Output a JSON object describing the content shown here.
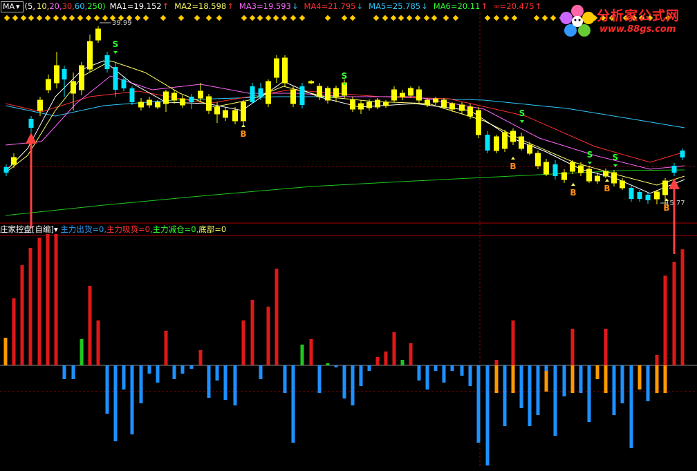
{
  "header": {
    "menu_label": "MA",
    "params_prefix": "(5,",
    "params": [
      {
        "text": "10,",
        "color": "#ffff66"
      },
      {
        "text": "20,",
        "color": "#ff66ff"
      },
      {
        "text": "30,",
        "color": "#ff3030"
      },
      {
        "text": "60,",
        "color": "#30c8ff"
      },
      {
        "text": "250)",
        "color": "#30ff30"
      }
    ],
    "ma_values": [
      {
        "text": "MA1=19.152",
        "arrow": "↑",
        "color": "#ffffff",
        "arrow_color": "#ff3030"
      },
      {
        "text": "MA2=18.598",
        "arrow": "↑",
        "color": "#ffff66",
        "arrow_color": "#ff3030"
      },
      {
        "text": "MA3=19.593",
        "arrow": "↓",
        "color": "#ff66ff",
        "arrow_color": "#30c8ff"
      },
      {
        "text": "MA4=21.795",
        "arrow": "↓",
        "color": "#ff3030",
        "arrow_color": "#30c8ff"
      },
      {
        "text": "MA5=25.785",
        "arrow": "↓",
        "color": "#30c8ff",
        "arrow_color": "#30c8ff"
      },
      {
        "text": "MA6=20.11",
        "arrow": "↑",
        "color": "#30ff30",
        "arrow_color": "#ff3030"
      },
      {
        "text": "∞=20.475",
        "arrow": "↑",
        "color": "#ff3030",
        "arrow_color": "#ff3030"
      }
    ]
  },
  "indicator": {
    "name": "庄家控盘[自编]",
    "items": [
      {
        "text": "主力出货=0,",
        "color": "#30a0ff"
      },
      {
        "text": "主力吸货=0",
        "color": "#ff3030"
      },
      {
        "text": ",主力减仓=0,",
        "color": "#30ff30"
      },
      {
        "text": "底部=0",
        "color": "#ffff66"
      }
    ]
  },
  "price_labels": {
    "high": "39.99",
    "low": "15.77"
  },
  "signal_labels": {
    "sell": "S",
    "buy": "B"
  },
  "logo": {
    "title": "分析家公式网",
    "url": "www.88gs.com"
  },
  "colors": {
    "up": "#ffff00",
    "down": "#00e5ff",
    "volume_red": "#e01818",
    "volume_blue": "#1e90ff",
    "volume_green": "#1ec81e",
    "volume_orange": "#ff9900",
    "grid": "#8b0000"
  },
  "chart_data": {
    "type": "candlestick_with_indicator",
    "price_range": {
      "high": 39.99,
      "low": 15.77
    },
    "ma_periods": [
      5,
      10,
      20,
      30,
      60,
      250
    ]
  }
}
